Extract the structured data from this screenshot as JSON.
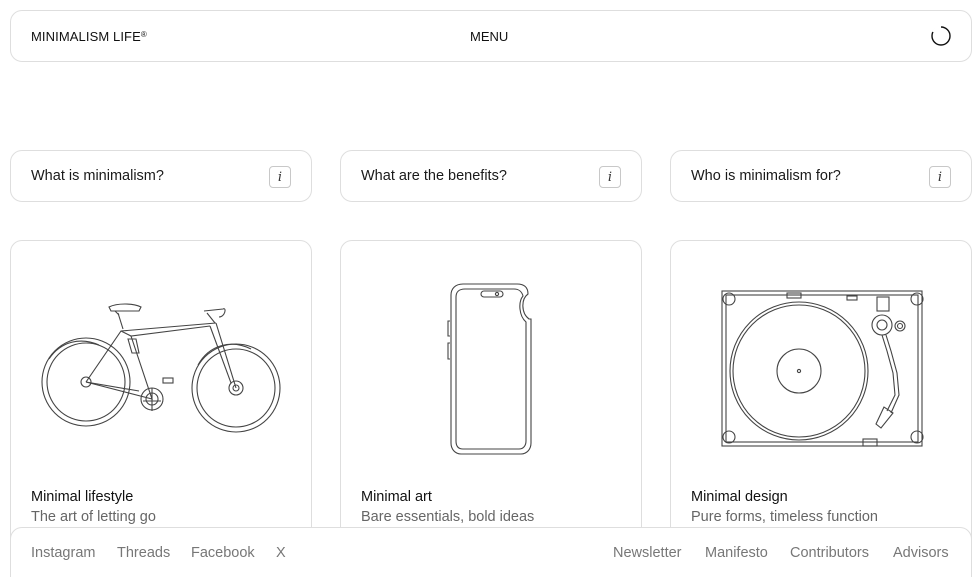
{
  "header": {
    "brand": "MINIMALISM LIFE",
    "brand_mark": "®",
    "menu_label": "MENU",
    "loader_icon": "loader-ring-icon"
  },
  "questions": [
    {
      "label": "What is minimalism?",
      "icon": "info-icon"
    },
    {
      "label": "What are the benefits?",
      "icon": "info-icon"
    },
    {
      "label": "Who is minimalism for?",
      "icon": "info-icon"
    }
  ],
  "cards": [
    {
      "title": "Minimal lifestyle",
      "subtitle": "The art of letting go",
      "illustration": "bicycle-illustration"
    },
    {
      "title": "Minimal art",
      "subtitle": "Bare essentials, bold ideas",
      "illustration": "smartphone-illustration"
    },
    {
      "title": "Minimal design",
      "subtitle": "Pure forms, timeless function",
      "illustration": "turntable-illustration"
    }
  ],
  "footer": {
    "social": [
      "Instagram",
      "Threads",
      "Facebook",
      "X"
    ],
    "links": [
      "Newsletter",
      "Manifesto",
      "Contributors",
      "Advisors"
    ]
  },
  "colors": {
    "border": "#dedede",
    "text": "#111111",
    "muted": "#666666",
    "link": "#777777"
  }
}
